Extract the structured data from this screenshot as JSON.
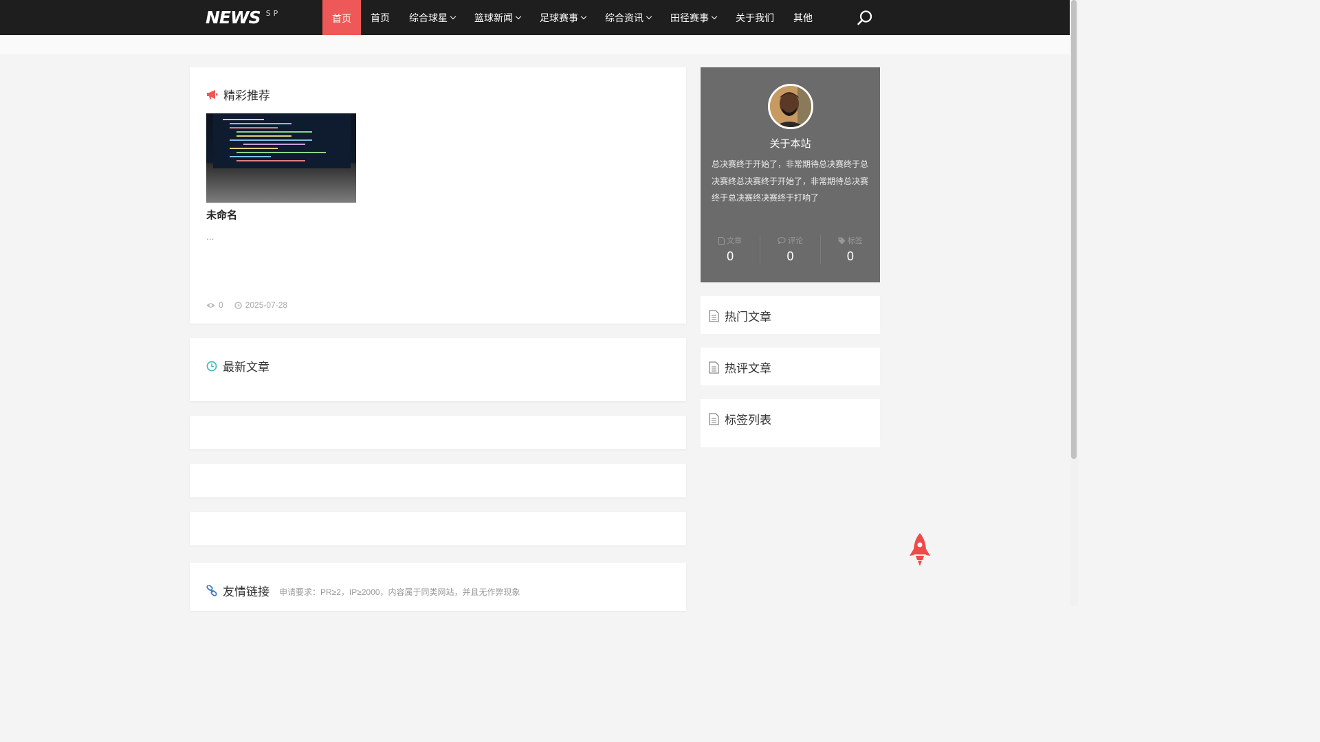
{
  "header": {
    "logo_main": "NEWS",
    "logo_sub": "SP",
    "nav": [
      {
        "label": "首页",
        "active": true,
        "dropdown": false
      },
      {
        "label": "首页",
        "active": false,
        "dropdown": false
      },
      {
        "label": "综合球星",
        "active": false,
        "dropdown": true
      },
      {
        "label": "篮球新闻",
        "active": false,
        "dropdown": true
      },
      {
        "label": "足球赛事",
        "active": false,
        "dropdown": true
      },
      {
        "label": "综合资讯",
        "active": false,
        "dropdown": true
      },
      {
        "label": "田径赛事",
        "active": false,
        "dropdown": true
      },
      {
        "label": "关于我们",
        "active": false,
        "dropdown": false
      },
      {
        "label": "其他",
        "active": false,
        "dropdown": false
      }
    ],
    "accent_color": "#ef5858"
  },
  "featured": {
    "heading": "精彩推荐",
    "post": {
      "title": "未命名",
      "excerpt": "...",
      "views": "0",
      "date": "2025-07-28"
    }
  },
  "latest": {
    "heading": "最新文章"
  },
  "links": {
    "heading": "友情链接",
    "note": "申请要求：PR≥2，IP≥2000，内容属于同类网站，并且无作弊现象"
  },
  "sidebar": {
    "about": {
      "title": "关于本站",
      "text": "总决赛终于开始了，非常期待总决赛终于总决赛终总决赛终于开始了，非常期待总决赛终于总决赛终决赛终于打响了",
      "stats": [
        {
          "label": "文章",
          "value": "0",
          "icon": "file-icon"
        },
        {
          "label": "评论",
          "value": "0",
          "icon": "comment-icon"
        },
        {
          "label": "标签",
          "value": "0",
          "icon": "tag-icon"
        }
      ]
    },
    "widgets": [
      {
        "title": "热门文章"
      },
      {
        "title": "热评文章"
      },
      {
        "title": "标签列表"
      }
    ]
  }
}
